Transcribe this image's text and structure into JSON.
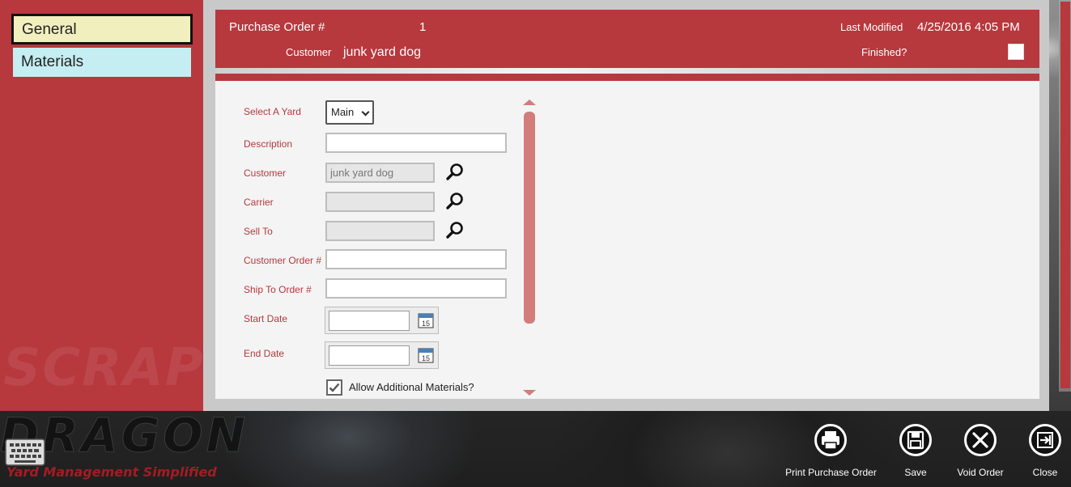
{
  "sidebar": {
    "items": [
      {
        "label": "General",
        "selected": true
      },
      {
        "label": "Materials",
        "selected": false
      }
    ],
    "watermark": "SCRAP"
  },
  "header": {
    "po_label": "Purchase Order #",
    "po_value": "1",
    "last_modified_label": "Last Modified",
    "last_modified_value": "4/25/2016 4:05 PM",
    "customer_label": "Customer",
    "customer_value": "junk yard dog",
    "finished_label": "Finished?",
    "finished_checked": false
  },
  "form": {
    "yard": {
      "label": "Select A Yard",
      "value": "Main"
    },
    "description": {
      "label": "Description",
      "value": ""
    },
    "customer": {
      "label": "Customer",
      "value": "junk yard dog"
    },
    "carrier": {
      "label": "Carrier",
      "value": ""
    },
    "sell_to": {
      "label": "Sell To",
      "value": ""
    },
    "customer_order": {
      "label": "Customer Order #",
      "value": ""
    },
    "ship_to_order": {
      "label": "Ship To Order #",
      "value": ""
    },
    "start_date": {
      "label": "Start Date",
      "value": ""
    },
    "end_date": {
      "label": "End Date",
      "value": ""
    },
    "calendar_day": "15",
    "allow_materials": {
      "label": "Allow Additional Materials?",
      "checked": true
    }
  },
  "brand": {
    "name": "DRAGON",
    "tagline": "Yard Management Simplified"
  },
  "app_bar": {
    "buttons": [
      {
        "label": "Print Purchase Order",
        "icon": "print-icon"
      },
      {
        "label": "Save",
        "icon": "save-icon"
      },
      {
        "label": "Void Order",
        "icon": "void-icon"
      },
      {
        "label": "Close",
        "icon": "close-app-icon"
      }
    ]
  },
  "colors": {
    "accent": "#b7383d",
    "general_tab": "#f2efbf",
    "materials_tab": "#c4eef2",
    "label_text": "#b7383d"
  }
}
